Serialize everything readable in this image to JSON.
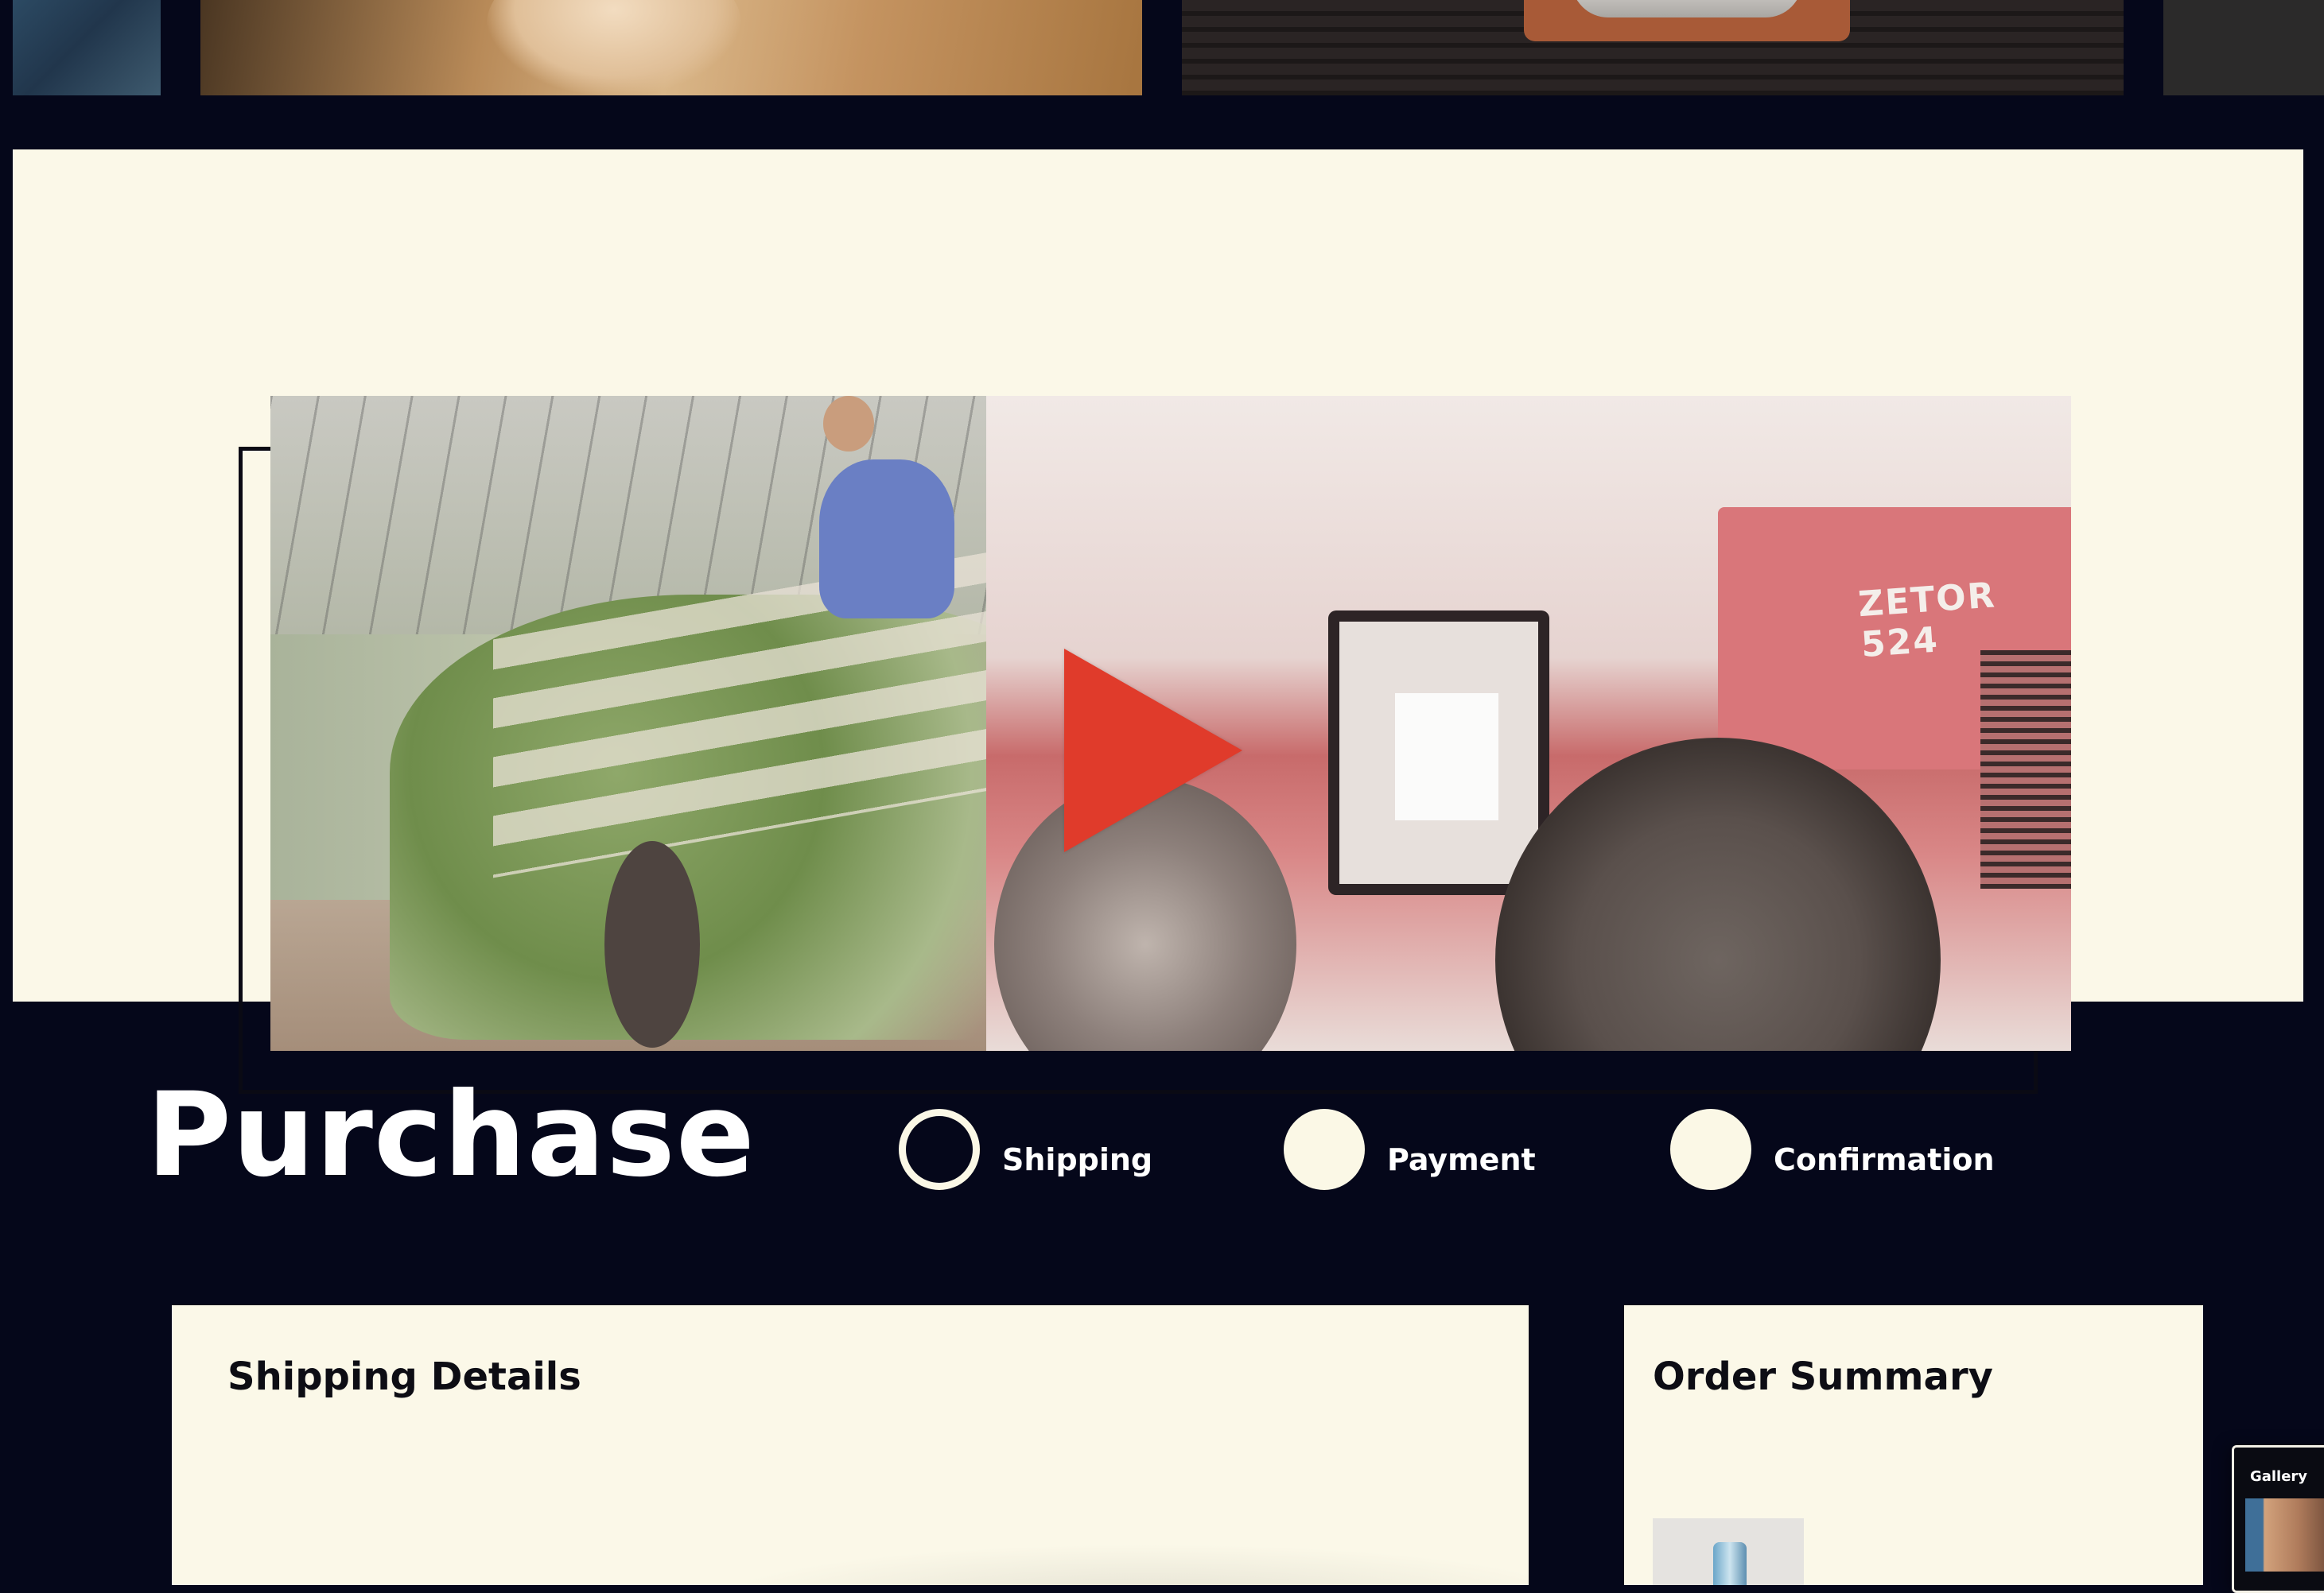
{
  "gallery_strip": {
    "items": [
      "thumb-a",
      "thumb-b",
      "thumb-c",
      "thumb-d"
    ]
  },
  "video": {
    "tractor_label": "ZETOR 524",
    "play_icon": "play-icon",
    "play_color": "#e03b2b"
  },
  "purchase": {
    "title": "Purchase",
    "steps": [
      {
        "label": "Shipping",
        "state": "current"
      },
      {
        "label": "Payment",
        "state": "upcoming"
      },
      {
        "label": "Confirmation",
        "state": "upcoming"
      }
    ]
  },
  "shipping_panel": {
    "title": "Shipping Details"
  },
  "summary_panel": {
    "title": "Order Summary"
  },
  "gallery_widget": {
    "label": "Gallery"
  },
  "colors": {
    "page_bg": "#05071a",
    "cream": "#fbf8e8",
    "accent_red": "#e03b2b"
  }
}
